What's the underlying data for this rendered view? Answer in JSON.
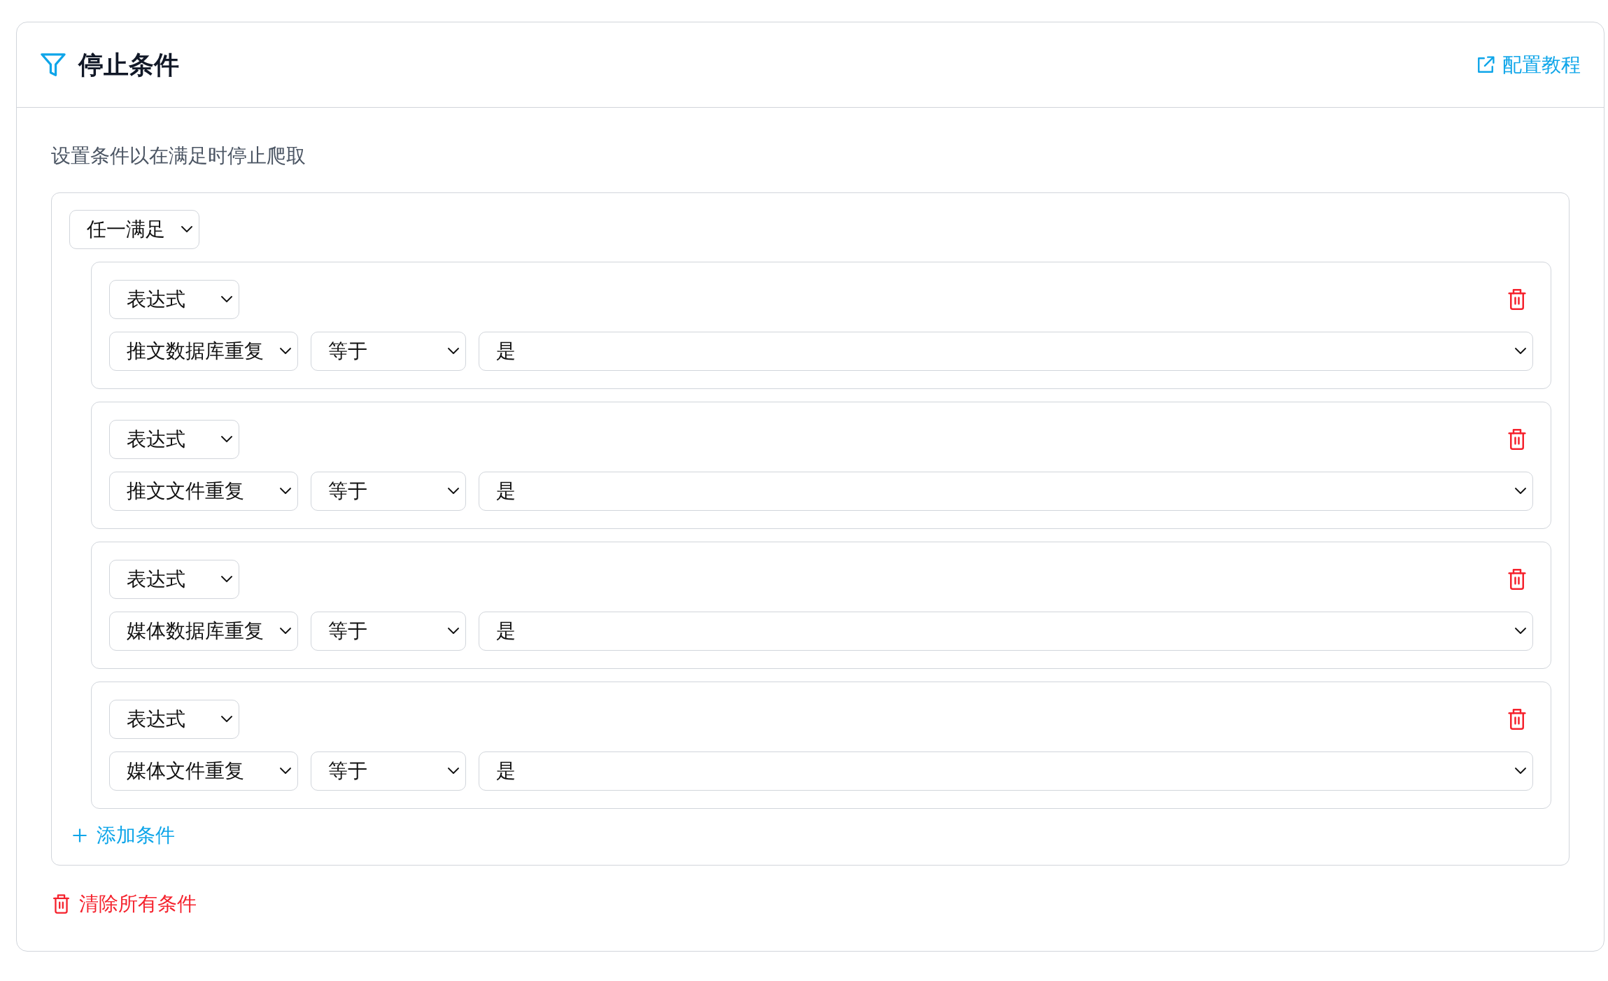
{
  "header": {
    "title": "停止条件",
    "link": "配置教程"
  },
  "description": "设置条件以在满足时停止爬取",
  "group": {
    "match": "任一满足",
    "conditions": [
      {
        "type": "表达式",
        "field": "推文数据库重复",
        "operator": "等于",
        "value": "是"
      },
      {
        "type": "表达式",
        "field": "推文文件重复",
        "operator": "等于",
        "value": "是"
      },
      {
        "type": "表达式",
        "field": "媒体数据库重复",
        "operator": "等于",
        "value": "是"
      },
      {
        "type": "表达式",
        "field": "媒体文件重复",
        "operator": "等于",
        "value": "是"
      }
    ],
    "add_button": "添加条件"
  },
  "clear_button": "清除所有条件"
}
